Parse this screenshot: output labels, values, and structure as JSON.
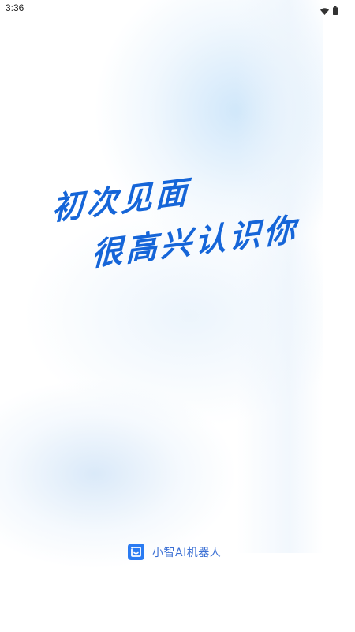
{
  "status_bar": {
    "time": "3:36",
    "icons": [
      "wifi-icon",
      "battery-icon"
    ]
  },
  "splash": {
    "line1": "初次见面",
    "line2": "很高兴认识你",
    "accent_color": "#1565d8"
  },
  "brand": {
    "logo_icon": "smile-chat-icon",
    "name": "小智AI机器人",
    "color": "#3a6fd4"
  }
}
